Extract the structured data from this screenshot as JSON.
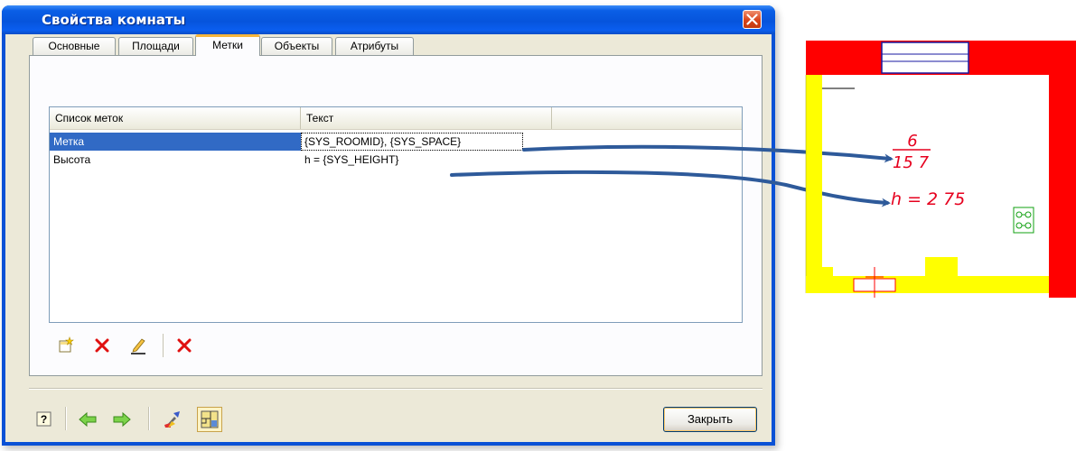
{
  "window": {
    "title": "Свойства комнаты"
  },
  "tabs": [
    {
      "label": "Основные",
      "active": false
    },
    {
      "label": "Площади",
      "active": false
    },
    {
      "label": "Метки",
      "active": true
    },
    {
      "label": "Объекты",
      "active": false
    },
    {
      "label": "Атрибуты",
      "active": false
    }
  ],
  "list": {
    "columns": [
      "Список меток",
      "Текст"
    ],
    "rows": [
      {
        "name": "Метка",
        "text": "{SYS_ROOMID}, {SYS_SPACE}",
        "selected": true
      },
      {
        "name": "Высота",
        "text": "h = {SYS_HEIGHT}",
        "selected": false
      }
    ]
  },
  "list_toolbar": {
    "icons": [
      "new-label-icon",
      "delete-icon",
      "edit-pencil-icon",
      "delete-all-icon"
    ]
  },
  "bottom_toolbar": {
    "icons": [
      "help-icon",
      "back-arrow-icon",
      "forward-arrow-icon",
      "paint-brush-icon",
      "floor-plan-icon"
    ],
    "close_label": "Закрыть"
  },
  "drawing": {
    "label_numerator": "6",
    "label_denominator": "15 7",
    "height_label": "h = 2 75"
  },
  "colors": {
    "wall_red": "#ff0000",
    "wall_yellow": "#ffff00",
    "annotation_red": "#e6001e",
    "arrow_blue": "#2e5a9a",
    "selection_blue": "#316ac5",
    "title_blue": "#0a5fe6"
  }
}
